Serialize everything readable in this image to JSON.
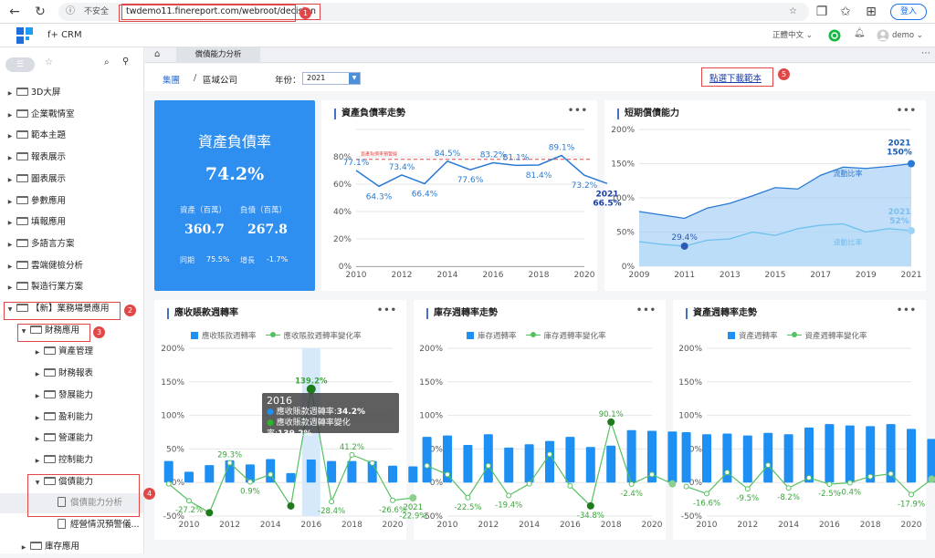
{
  "browser": {
    "insecure_label": "不安全",
    "url": "twdemo11.finereport.com/webroot/decision",
    "login_label": "登入"
  },
  "app": {
    "name": "f+ CRM",
    "language": "正體中文",
    "user": "demo"
  },
  "sidebar": {
    "items": [
      {
        "label": "3D大屏"
      },
      {
        "label": "企業戰情室"
      },
      {
        "label": "範本主題"
      },
      {
        "label": "報表展示"
      },
      {
        "label": "圖表展示"
      },
      {
        "label": "參數應用"
      },
      {
        "label": "填報應用"
      },
      {
        "label": "多語言方案"
      },
      {
        "label": "雲端健檢分析"
      },
      {
        "label": "製造行業方案"
      },
      {
        "label": "【新】業務場景應用"
      },
      {
        "label": "財務應用"
      },
      {
        "label": "資產管理"
      },
      {
        "label": "財務報表"
      },
      {
        "label": "發展能力"
      },
      {
        "label": "盈利能力"
      },
      {
        "label": "營運能力"
      },
      {
        "label": "控制能力"
      },
      {
        "label": "償債能力"
      },
      {
        "label": "償債能力分析"
      },
      {
        "label": "經營情況預警儀..."
      },
      {
        "label": "庫存應用"
      }
    ]
  },
  "tabs": {
    "active": "償債能力分析"
  },
  "filters": {
    "breadcrumb_group": "集團",
    "breadcrumb_sep": "/",
    "breadcrumb_region": "區域公司",
    "year_label": "年份：",
    "year_value": "2021",
    "download_link": "點選下載範本"
  },
  "badges": [
    "1",
    "2",
    "3",
    "4",
    "5"
  ],
  "kpi": {
    "title": "資產負債率",
    "value": "74.2%",
    "assets_label": "資產（百萬）",
    "liab_label": "負債（百萬）",
    "assets_value": "360.7",
    "liab_value": "267.8",
    "yoy_label": "同期",
    "yoy_value": "75.5%",
    "growth_label": "增長",
    "growth_value": "-1.7%"
  },
  "charts": {
    "debt_ratio": {
      "title": "資產負債率走勢",
      "warning_label": "資產負債率預警線"
    },
    "short_term": {
      "title": "短期償債能力",
      "series_label_current": "流動比率",
      "series_label_quick": "速動比率"
    },
    "ar_turnover": {
      "title": "應收賬款週轉率",
      "legend_bar": "應收賬款週轉率",
      "legend_line": "應收賬款週轉率變化率"
    },
    "inv_turnover": {
      "title": "庫存週轉率走勢",
      "legend_bar": "庫存週轉率",
      "legend_line": "庫存週轉率變化率"
    },
    "asset_turnover": {
      "title": "資產週轉率走勢",
      "legend_bar": "資產週轉率",
      "legend_line": "資產週轉率變化率"
    }
  },
  "tooltip": {
    "year": "2016",
    "line1_label": "應收賬款週轉率:",
    "line1_value": "34.2%",
    "line2_label": "應收賬款週轉率變化率:",
    "line2_value": "139.2%"
  },
  "chart_data": [
    {
      "type": "line",
      "title": "資產負債率走勢",
      "x": [
        2009,
        2010,
        2011,
        2012,
        2013,
        2014,
        2015,
        2016,
        2017,
        2018,
        2019,
        2020,
        2021
      ],
      "series": [
        {
          "values": [
            82,
            77.1,
            64.3,
            73.4,
            66.4,
            84.5,
            77.6,
            83.2,
            81.1,
            81.4,
            89.1,
            73.2,
            66.5
          ]
        }
      ],
      "point_labels": [
        "",
        "77.1%",
        "64.3%",
        "73.4%",
        "66.4%",
        "84.5%",
        "77.6%",
        "83.2%",
        "81.1%",
        "81.4%",
        "89.1%",
        "73.2%",
        "2021\n66.5%"
      ],
      "reference_line": 86,
      "ylim": [
        0,
        100
      ],
      "yticks": [
        "0%",
        "20%",
        "40%",
        "60%",
        "80%"
      ],
      "xticks": [
        "2010",
        "2012",
        "2014",
        "2016",
        "2018",
        "2020"
      ]
    },
    {
      "type": "area",
      "title": "短期償債能力",
      "x": [
        2009,
        2010,
        2011,
        2012,
        2013,
        2014,
        2015,
        2016,
        2017,
        2018,
        2019,
        2020,
        2021
      ],
      "series": [
        {
          "name": "流動比率",
          "values": [
            80,
            75,
            70,
            85,
            92,
            103,
            115,
            113,
            133,
            145,
            143,
            146,
            150
          ]
        },
        {
          "name": "速動比率",
          "values": [
            36,
            32,
            29.4,
            38,
            40,
            50,
            45,
            55,
            60,
            62,
            50,
            55,
            52
          ]
        }
      ],
      "ylim": [
        0,
        200
      ],
      "yticks": [
        "0%",
        "50%",
        "100%",
        "150%",
        "200%"
      ],
      "xticks": [
        "2009",
        "2011",
        "2013",
        "2015",
        "2017",
        "2019",
        "2021"
      ],
      "point_labels": {
        "2011": "29.4%",
        "current_end": "2021\n150%",
        "quick_end": "2021\n52%"
      }
    },
    {
      "type": "bar",
      "title": "應收賬款週轉率",
      "x": [
        2009,
        2010,
        2011,
        2012,
        2013,
        2014,
        2015,
        2016,
        2017,
        2018,
        2019,
        2020,
        2021
      ],
      "series": [
        {
          "name": "應收賬款週轉率",
          "values": [
            32,
            16,
            26,
            33,
            27,
            35,
            14,
            34.2,
            32,
            32,
            32,
            25,
            24
          ]
        },
        {
          "name": "應收賬款週轉率變化率",
          "values": [
            -2,
            -27.2,
            -45,
            29.3,
            0.9,
            12,
            -35,
            139.2,
            -28.4,
            41.2,
            29,
            -26.6,
            -22.9
          ]
        }
      ],
      "ylim": [
        -50,
        200
      ],
      "yticks": [
        "-50%",
        "0%",
        "50%",
        "100%",
        "150%",
        "200%"
      ],
      "xticks": [
        "2010",
        "2012",
        "2014",
        "2016",
        "2018",
        "2020"
      ],
      "point_labels": [
        "",
        "-27.2%",
        "",
        "29.3%",
        "0.9%",
        "",
        "",
        "139.2%",
        "-28.4%",
        "41.2%",
        "",
        "-26.6%",
        "2021\n-22.9%"
      ]
    },
    {
      "type": "bar",
      "title": "庫存週轉率走勢",
      "x": [
        2009,
        2010,
        2011,
        2012,
        2013,
        2014,
        2015,
        2016,
        2017,
        2018,
        2019,
        2020,
        2021
      ],
      "series": [
        {
          "name": "庫存週轉率",
          "values": [
            68,
            70,
            56,
            72,
            52,
            57,
            62,
            68,
            53,
            55,
            78,
            77,
            76
          ]
        },
        {
          "name": "庫存週轉率變化率",
          "values": [
            25,
            12,
            -22.5,
            25,
            -19.4,
            -2,
            42,
            -5,
            -34.8,
            90.1,
            -2.4,
            12,
            -2
          ]
        }
      ],
      "ylim": [
        -50,
        200
      ],
      "yticks": [
        "-50%",
        "0%",
        "50%",
        "100%",
        "150%",
        "200%"
      ],
      "xticks": [
        "2010",
        "2012",
        "2014",
        "2016",
        "2018",
        "2020"
      ],
      "point_labels": [
        "",
        "",
        "-22.5%",
        "",
        "-19.4%",
        "",
        "",
        "",
        "-34.8%",
        "90.1%",
        "-2.4%",
        "",
        ""
      ]
    },
    {
      "type": "bar",
      "title": "資產週轉率走勢",
      "x": [
        2009,
        2010,
        2011,
        2012,
        2013,
        2014,
        2015,
        2016,
        2017,
        2018,
        2019,
        2020,
        2021
      ],
      "series": [
        {
          "name": "資產週轉率",
          "values": [
            75,
            72,
            73,
            70,
            74,
            72,
            82,
            87,
            85,
            84,
            87,
            80,
            65
          ]
        },
        {
          "name": "資產週轉率變化率",
          "values": [
            -6,
            -16.6,
            15,
            -9.5,
            26,
            -8.2,
            7,
            -2.5,
            -0.4,
            9,
            13,
            -17.9,
            5
          ]
        }
      ],
      "ylim": [
        -50,
        200
      ],
      "yticks": [
        "-50%",
        "0%",
        "50%",
        "100%",
        "150%",
        "200%"
      ],
      "xticks": [
        "2010",
        "2012",
        "2014",
        "2016",
        "2018",
        "2020"
      ],
      "point_labels": [
        "",
        "-16.6%",
        "",
        "-9.5%",
        "",
        "-8.2%",
        "",
        "-2.5%",
        "-0.4%",
        "",
        "",
        "-17.9%",
        ""
      ]
    }
  ]
}
